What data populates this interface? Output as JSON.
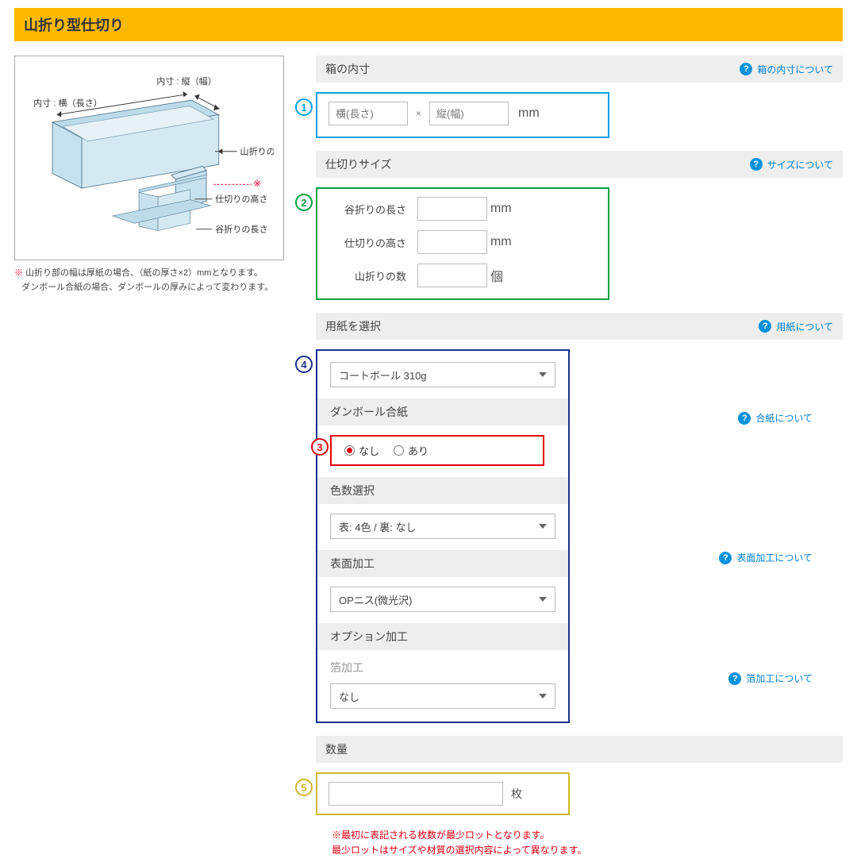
{
  "title": "山折り型仕切り",
  "diagram": {
    "label_inner_width": "内寸 : 横（長さ）",
    "label_inner_depth": "内寸 : 縦（幅）",
    "label_fold_count": "山折りの数",
    "label_divider_height": "仕切りの高さ",
    "label_valley_length": "谷折りの長さ",
    "asterisk": "※"
  },
  "note": {
    "line1_prefix": "※ ",
    "line1": "山折り部の幅は厚紙の場合、（紙の厚さ×2）mmとなります。",
    "line2": "ダンボール合紙の場合、ダンボールの厚みによって変わります。"
  },
  "sections": {
    "s1": {
      "header": "箱の内寸",
      "help": "箱の内寸について",
      "placeholder_w": "横(長さ)",
      "placeholder_d": "縦(幅)",
      "unit": "mm",
      "times": "×"
    },
    "s2": {
      "header": "仕切りサイズ",
      "help": "サイズについて",
      "rows": [
        {
          "label": "谷折りの長さ",
          "unit": "mm"
        },
        {
          "label": "仕切りの高さ",
          "unit": "mm"
        },
        {
          "label": "山折りの数",
          "unit": "個"
        }
      ]
    },
    "s3": {
      "header": "用紙を選択",
      "help": "用紙について"
    },
    "s4": {
      "paper_select": "コートボール 310g",
      "laminate_header": "ダンボール合紙",
      "laminate_help": "合紙について",
      "radio_none": "なし",
      "radio_yes": "あり",
      "color_header": "色数選択",
      "color_select": "表: 4色 / 裏: なし",
      "surface_header": "表面加工",
      "surface_help": "表面加工について",
      "surface_select": "OPニス(微光沢)",
      "option_header": "オプション加工",
      "option_label": "箔加工",
      "option_help": "箔加工について",
      "option_select": "なし"
    },
    "s5": {
      "header": "数量",
      "unit": "枚",
      "note1": "※最初に表記される枚数が最少ロットとなります。",
      "note2": "最少ロットはサイズや材質の選択内容によって異なります。"
    }
  },
  "badges": {
    "b1": "1",
    "b2": "2",
    "b3": "3",
    "b4": "4",
    "b5": "5"
  }
}
